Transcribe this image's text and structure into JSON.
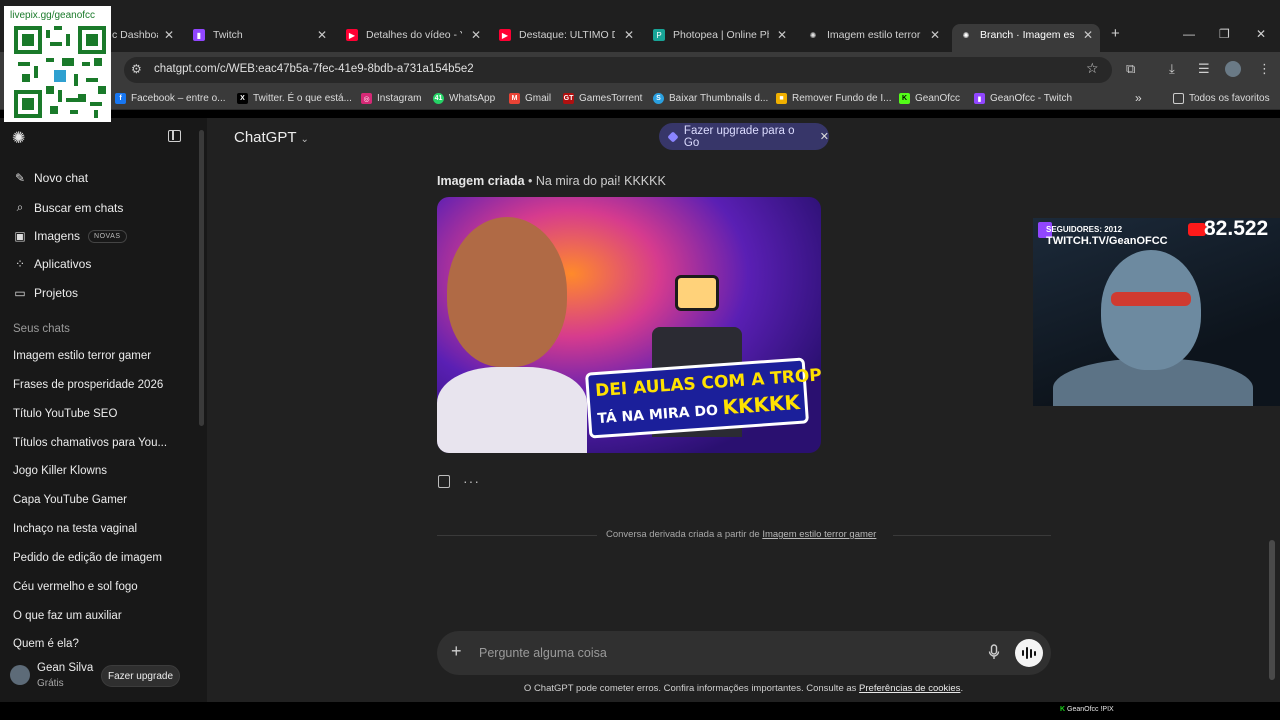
{
  "qr": {
    "text": "livepix.gg/geanofcc"
  },
  "tabs": [
    {
      "title": "c Dashboa",
      "icon": "dashboard-icon",
      "color": "#c02020"
    },
    {
      "title": "Twitch",
      "icon": "twitch-icon",
      "color": "#9146ff"
    },
    {
      "title": "Detalhes do vídeo - Yo",
      "icon": "youtube-studio-icon",
      "color": "#ff0033"
    },
    {
      "title": "Destaque: ULTIMO DO",
      "icon": "youtube-icon",
      "color": "#ff0033"
    },
    {
      "title": "Photopea | Online Pho",
      "icon": "photopea-icon",
      "color": "#18a497"
    },
    {
      "title": "Imagem estilo terror g",
      "icon": "chatgpt-icon",
      "color": "#ffffff"
    },
    {
      "title": "Branch · Imagem estilo",
      "icon": "chatgpt-icon",
      "color": "#ffffff"
    }
  ],
  "address": {
    "url": "chatgpt.com/c/WEB:eac47b5a-7fec-41e9-8bdb-a731a154b5e2"
  },
  "bookmarks": [
    {
      "label": "Facebook – entre o...",
      "icon": "facebook-icon",
      "color": "#1877f2"
    },
    {
      "label": "Twitter. É o que está...",
      "icon": "x-icon",
      "color": "#000000"
    },
    {
      "label": "Instagram",
      "icon": "instagram-icon",
      "color": "#d62976"
    },
    {
      "label": "WhatsApp",
      "icon": "whatsapp-icon",
      "color": "#25d366"
    },
    {
      "label": "Gmail",
      "icon": "gmail-icon",
      "color": "#ea4335"
    },
    {
      "label": "GamesTorrent",
      "icon": "gamestorrent-icon",
      "color": "#b01010"
    },
    {
      "label": "Baixar Thumbnails d...",
      "icon": "thumbnail-icon",
      "color": "#2aa0e0"
    },
    {
      "label": "Remover Fundo de I...",
      "icon": "removebg-icon",
      "color": "#f0b000"
    },
    {
      "label": "GeanOfcc",
      "icon": "kick-icon",
      "color": "#53fc18"
    },
    {
      "label": "GeanOfcc - Twitch",
      "icon": "twitch-icon",
      "color": "#9146ff"
    }
  ],
  "bookmarks_all": "Todos os favoritos",
  "sidebar": {
    "nav": [
      {
        "label": "Novo chat",
        "icon": "new-chat-icon"
      },
      {
        "label": "Buscar em chats",
        "icon": "search-icon"
      },
      {
        "label": "Imagens",
        "icon": "images-icon",
        "badge": "NOVAS"
      },
      {
        "label": "Aplicativos",
        "icon": "apps-icon"
      },
      {
        "label": "Projetos",
        "icon": "folder-icon"
      }
    ],
    "section": "Seus chats",
    "chats": [
      "Imagem estilo terror gamer",
      "Frases de prosperidade 2026",
      "Título YouTube SEO",
      "Títulos chamativos para You...",
      "Jogo Killer Klowns",
      "Capa YouTube Gamer",
      "Inchaço na testa vaginal",
      "Pedido de edição de imagem",
      "Céu vermelho e sol fogo",
      "O que faz um auxiliar",
      "Quem é ela?"
    ],
    "user": {
      "name": "Gean Silva",
      "plan": "Grátis",
      "upgrade": "Fazer upgrade"
    }
  },
  "header": {
    "model": "ChatGPT",
    "upgrade_pill": "Fazer upgrade para o Go"
  },
  "message": {
    "caption_bold": "Imagem criada",
    "caption_rest": " • Na mira do pai! KKKKK",
    "thumbnail_text1": "DEI AULAS COM A TROP!",
    "thumbnail_text2": "TÁ NA MIRA DO",
    "thumbnail_text3": "KKKKK"
  },
  "branch_note": {
    "prefix": "Conversa derivada criada a partir de ",
    "link": "Imagem estilo terror gamer"
  },
  "composer": {
    "placeholder": "Pergunte alguma coisa"
  },
  "disclaimer": {
    "text": "O ChatGPT pode cometer erros. Confira informações importantes. Consulte as ",
    "link": "Preferências de cookies",
    "end": "."
  },
  "webcam": {
    "followers": "SEGUIDORES: 2012",
    "channel": "TWITCH.TV/GeanOFCC",
    "count": "82.522"
  },
  "stream_tag": {
    "name": "GeanOfcc",
    "cmd": "!PIX"
  }
}
